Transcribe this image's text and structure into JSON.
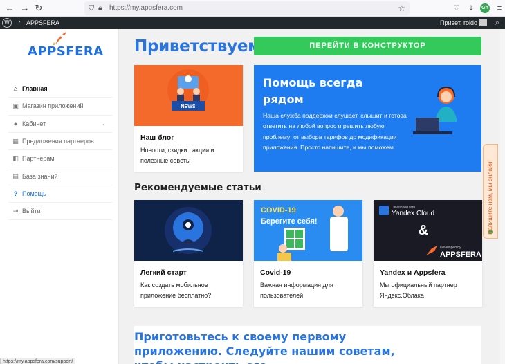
{
  "browser": {
    "url": "https://my.appsfera.com",
    "back_icon": "arrow-left",
    "forward_icon": "arrow-right",
    "reload_icon": "reload",
    "ext_badge": "Gh",
    "status_url": "https://my.appsfera.com/support/"
  },
  "adminbar": {
    "site_name": "APPSFERA",
    "greeting": "Привет, roldo"
  },
  "sidebar": {
    "logo": "APPSFERA",
    "items": [
      {
        "label": "Главная",
        "icon": "home-icon"
      },
      {
        "label": "Магазин приложений",
        "icon": "store-icon"
      },
      {
        "label": "Кабинет",
        "icon": "user-icon"
      },
      {
        "label": "Предложения партнеров",
        "icon": "gift-icon"
      },
      {
        "label": "Партнерам",
        "icon": "handshake-icon"
      },
      {
        "label": "База знаний",
        "icon": "book-icon"
      },
      {
        "label": "Помощь",
        "icon": "question-icon"
      },
      {
        "label": "Выйти",
        "icon": "logout-icon"
      }
    ]
  },
  "main": {
    "title": "Приветствуем!",
    "cta": "ПЕРЕЙТИ В КОНСТРУКТОР",
    "blog": {
      "title": "Наш блог",
      "desc": "Новости, скидки , акции и полезные советы",
      "badge": "NEWS"
    },
    "help": {
      "title": "Помощь всегда рядом",
      "desc": "Наша служба поддержки слушает, слышит и готова ответить на любой вопрос и решить любую проблему: от выбора тарифов до модификации приложения. Просто напишите, и мы поможем."
    },
    "section_title": "Рекомендуемые статьи",
    "articles": [
      {
        "title": "Легкий старт",
        "desc": "Как создать мобильное приложение бесплатно?"
      },
      {
        "title": "Covid-19",
        "desc": "Важная информация для пользователей",
        "img_line1": "COVID-19",
        "img_line2": "Берегите себя!"
      },
      {
        "title": "Yandex и Appsfera",
        "desc": "Мы официальный партнер Яндекс.Облака",
        "img_dev": "Developed with",
        "img_yandex": "Yandex Cloud",
        "img_amp": "&",
        "img_devby": "Developed by",
        "img_appsfera": "APPSFERA"
      }
    ],
    "bottom_text": "Приготовьтесь к своему первому приложению. Следуйте нашим советам, чтобы настроить его."
  },
  "side_tab": "Напишите нам, мы онлайн!",
  "colors": {
    "accent": "#2a74e0",
    "cta": "#34c95b",
    "help_bg": "#1e7cf0",
    "blog_bg": "#f36a2b",
    "dark_card": "#0f2248"
  }
}
